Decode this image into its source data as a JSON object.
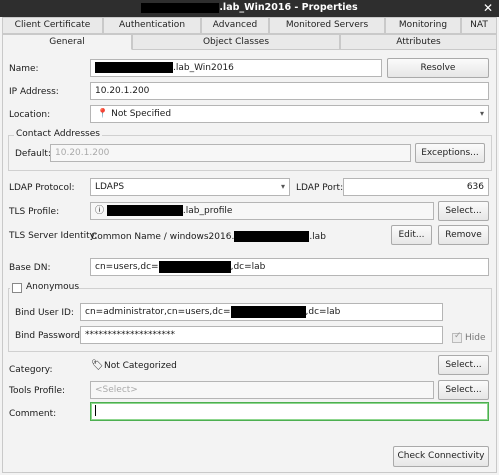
{
  "window": {
    "title_suffix": ".lab_Win2016 - Properties",
    "close_glyph": "✕"
  },
  "tabs_row1": [
    "Client Certificate",
    "Authentication",
    "Advanced",
    "Monitored Servers",
    "Monitoring",
    "NAT"
  ],
  "tabs_row2": [
    "General",
    "Object Classes",
    "Attributes"
  ],
  "form": {
    "name_label": "Name:",
    "name_suffix": ".lab_Win2016",
    "resolve_button": "Resolve",
    "ip_label": "IP Address:",
    "ip_value": "10.20.1.200",
    "location_label": "Location:",
    "location_value": "Not Specified",
    "contact_group": "Contact Addresses",
    "default_label": "Default:",
    "default_value": "10.20.1.200",
    "exceptions_button": "Exceptions...",
    "ldap_protocol_label": "LDAP Protocol:",
    "ldap_protocol_value": "LDAPS",
    "ldap_port_label": "LDAP Port:",
    "ldap_port_value": "636",
    "tls_profile_label": "TLS Profile:",
    "tls_profile_suffix": ".lab_profile",
    "select_button": "Select...",
    "tls_identity_label": "TLS Server Identity:",
    "tls_identity_prefix": "Common Name / windows2016.",
    "tls_identity_suffix": ".lab",
    "edit_button": "Edit...",
    "remove_button": "Remove",
    "base_dn_label": "Base DN:",
    "base_dn_prefix": "cn=users,dc=",
    "base_dn_suffix": ",dc=lab",
    "anonymous_label": "Anonymous",
    "bind_user_label": "Bind User ID:",
    "bind_user_prefix": "cn=administrator,cn=users,dc=",
    "bind_user_suffix": ",dc=lab",
    "bind_password_label": "Bind Password:",
    "bind_password_value": "********************",
    "hide_label": "Hide",
    "category_label": "Category:",
    "category_value": "Not Categorized",
    "tools_profile_label": "Tools Profile:",
    "tools_profile_placeholder": "<Select>",
    "comment_label": "Comment:",
    "check_connectivity_button": "Check Connectivity"
  },
  "colors": {
    "titlebar": "#2e2e2e",
    "focus": "#4caf50"
  }
}
